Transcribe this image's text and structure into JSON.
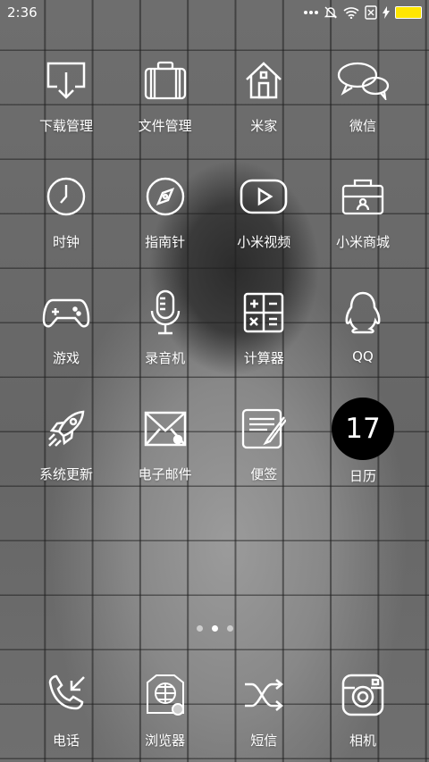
{
  "status_bar": {
    "time": "2:36"
  },
  "apps": [
    {
      "label": "下载管理",
      "icon": "download-icon"
    },
    {
      "label": "文件管理",
      "icon": "briefcase-icon"
    },
    {
      "label": "米家",
      "icon": "house-icon"
    },
    {
      "label": "微信",
      "icon": "chat-bubbles-icon"
    },
    {
      "label": "时钟",
      "icon": "clock-icon"
    },
    {
      "label": "指南针",
      "icon": "compass-icon"
    },
    {
      "label": "小米视频",
      "icon": "play-icon"
    },
    {
      "label": "小米商城",
      "icon": "shop-icon"
    },
    {
      "label": "游戏",
      "icon": "gamepad-icon"
    },
    {
      "label": "录音机",
      "icon": "microphone-icon"
    },
    {
      "label": "计算器",
      "icon": "calculator-icon"
    },
    {
      "label": "QQ",
      "icon": "penguin-icon"
    },
    {
      "label": "系统更新",
      "icon": "rocket-icon"
    },
    {
      "label": "电子邮件",
      "icon": "envelope-icon"
    },
    {
      "label": "便签",
      "icon": "notepad-icon"
    },
    {
      "label": "日历",
      "icon": "calendar-icon",
      "day": "17"
    }
  ],
  "page_indicator": {
    "pages": 3,
    "active": 2
  },
  "dock": [
    {
      "label": "电话",
      "icon": "phone-icon"
    },
    {
      "label": "浏览器",
      "icon": "browser-icon"
    },
    {
      "label": "短信",
      "icon": "shuffle-icon"
    },
    {
      "label": "相机",
      "icon": "camera-icon"
    }
  ],
  "colors": {
    "battery": "#ffe600",
    "calendar_bg": "#000000"
  }
}
